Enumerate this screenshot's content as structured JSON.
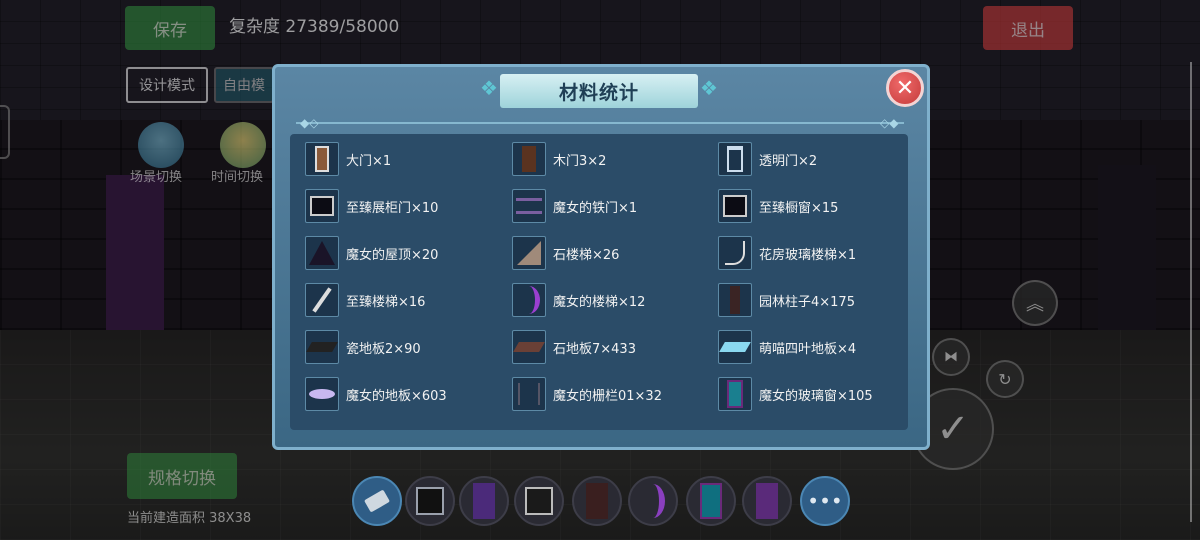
{
  "hud": {
    "save_label": "保存",
    "complexity": "复杂度 27389/58000",
    "exit_label": "退出",
    "design_mode_label": "设计模式",
    "free_mode_label": "自由模",
    "scene_switch_label": "场景切换",
    "time_switch_label": "时间切换",
    "spec_switch_label": "规格切换",
    "build_area": "当前建造面积 38X38"
  },
  "dialog": {
    "title": "材料统计",
    "close_glyph": "✕",
    "items": [
      {
        "label": "大门×1",
        "icon": "gate-icon"
      },
      {
        "label": "木门3×2",
        "icon": "wooden-door-icon"
      },
      {
        "label": "透明门×2",
        "icon": "transparent-door-icon"
      },
      {
        "label": "至臻展柜门×10",
        "icon": "display-cabinet-door-icon"
      },
      {
        "label": "魔女的铁门×1",
        "icon": "witch-iron-gate-icon"
      },
      {
        "label": "至臻橱窗×15",
        "icon": "showcase-window-icon"
      },
      {
        "label": "魔女的屋顶×20",
        "icon": "witch-roof-icon"
      },
      {
        "label": "石楼梯×26",
        "icon": "stone-stairs-icon"
      },
      {
        "label": "花房玻璃楼梯×1",
        "icon": "glass-stairs-icon"
      },
      {
        "label": "至臻楼梯×16",
        "icon": "premium-stairs-icon"
      },
      {
        "label": "魔女的楼梯×12",
        "icon": "witch-stairs-icon"
      },
      {
        "label": "园林柱子4×175",
        "icon": "garden-pillar-icon"
      },
      {
        "label": "瓷地板2×90",
        "icon": "porcelain-floor-icon"
      },
      {
        "label": "石地板7×433",
        "icon": "stone-floor-icon"
      },
      {
        "label": "萌喵四叶地板×4",
        "icon": "clover-floor-icon"
      },
      {
        "label": "魔女的地板×603",
        "icon": "witch-floor-icon"
      },
      {
        "label": "魔女的栅栏01×32",
        "icon": "witch-fence-icon"
      },
      {
        "label": "魔女的玻璃窗×105",
        "icon": "witch-glass-window-icon"
      }
    ]
  },
  "hotbar": [
    "eraser-icon",
    "window-block-icon",
    "purple-pillar-icon",
    "cabinet-door-icon",
    "dark-door-icon",
    "crescent-stairs-icon",
    "glass-window-icon",
    "purple-wall-icon",
    "more-icon"
  ]
}
